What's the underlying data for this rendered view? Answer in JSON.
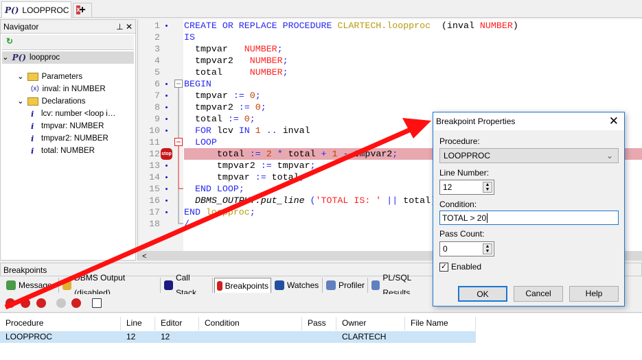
{
  "doc_tab": {
    "icon": "procedure-icon",
    "label": "LOOPPROC",
    "close": "x",
    "add": "+"
  },
  "navigator": {
    "title": "Navigator",
    "pin": "⊥",
    "close": "✕",
    "refresh": "↻",
    "root": "loopproc",
    "items": [
      {
        "label": "Parameters",
        "icon": "folder-icon"
      },
      {
        "label": "inval: in NUMBER",
        "icon": "parameter-icon",
        "glyph": "(x)"
      },
      {
        "label": "Declarations",
        "icon": "folder-icon"
      },
      {
        "label": "lcv: number  <loop i…",
        "icon": "variable-icon"
      },
      {
        "label": "tmpvar: NUMBER",
        "icon": "variable-icon"
      },
      {
        "label": "tmpvar2: NUMBER",
        "icon": "variable-icon"
      },
      {
        "label": "total: NUMBER",
        "icon": "variable-icon"
      }
    ]
  },
  "editor": {
    "breakpoint_line": 12,
    "breakpoint_label": "stop",
    "dots": [
      1,
      6,
      7,
      8,
      9,
      10,
      13,
      14,
      15,
      16,
      17
    ],
    "lines": [
      [
        [
          "kw",
          "CREATE OR REPLACE PROCEDURE "
        ],
        [
          "nm",
          "CLARTECH.loopproc"
        ],
        [
          "",
          "  (inval "
        ],
        [
          "ty",
          "NUMBER"
        ],
        [
          "",
          ")"
        ]
      ],
      [
        [
          "kw",
          "IS"
        ]
      ],
      [
        [
          "",
          "  tmpvar   "
        ],
        [
          "ty",
          "NUMBER"
        ],
        [
          "op",
          ";"
        ]
      ],
      [
        [
          "",
          "  tmpvar2   "
        ],
        [
          "ty",
          "NUMBER"
        ],
        [
          "op",
          ";"
        ]
      ],
      [
        [
          "",
          "  total     "
        ],
        [
          "ty",
          "NUMBER"
        ],
        [
          "op",
          ";"
        ]
      ],
      [
        [
          "kw",
          "BEGIN"
        ]
      ],
      [
        [
          "",
          "  tmpvar "
        ],
        [
          "op",
          ":="
        ],
        [
          "",
          " "
        ],
        [
          "nu",
          "0"
        ],
        [
          "op",
          ";"
        ]
      ],
      [
        [
          "",
          "  tmpvar2 "
        ],
        [
          "op",
          ":="
        ],
        [
          "",
          " "
        ],
        [
          "nu",
          "0"
        ],
        [
          "op",
          ";"
        ]
      ],
      [
        [
          "",
          "  total "
        ],
        [
          "op",
          ":="
        ],
        [
          "",
          " "
        ],
        [
          "nu",
          "0"
        ],
        [
          "op",
          ";"
        ]
      ],
      [
        [
          "",
          "  "
        ],
        [
          "kw",
          "FOR"
        ],
        [
          "",
          " lcv "
        ],
        [
          "kw",
          "IN"
        ],
        [
          "",
          " "
        ],
        [
          "nu",
          "1"
        ],
        [
          "",
          " "
        ],
        [
          "op",
          ".."
        ],
        [
          "",
          " inval"
        ]
      ],
      [
        [
          "",
          "  "
        ],
        [
          "kw",
          "LOOP"
        ]
      ],
      [
        [
          "",
          "      total "
        ],
        [
          "op",
          ":="
        ],
        [
          "nu",
          " 2 "
        ],
        [
          "op",
          "*"
        ],
        [
          "",
          " total "
        ],
        [
          "op",
          "+"
        ],
        [
          "nu",
          " 1 "
        ],
        [
          "op",
          "-"
        ],
        [
          "",
          " tmpvar2"
        ],
        [
          "op",
          ";"
        ]
      ],
      [
        [
          "",
          "      tmpvar2 "
        ],
        [
          "op",
          ":="
        ],
        [
          "",
          " tmpvar"
        ],
        [
          "op",
          ";"
        ]
      ],
      [
        [
          "",
          "      tmpvar "
        ],
        [
          "op",
          ":="
        ],
        [
          "",
          " total"
        ],
        [
          "op",
          ";"
        ]
      ],
      [
        [
          "",
          "  "
        ],
        [
          "kw",
          "END LOOP"
        ],
        [
          "op",
          ";"
        ]
      ],
      [
        [
          "",
          "  "
        ],
        [
          "it",
          "DBMS_OUTPUT.put_line"
        ],
        [
          "",
          " "
        ],
        [
          "op",
          "("
        ],
        [
          "st",
          "'TOTAL IS: '"
        ],
        [
          "op",
          " || "
        ],
        [
          "",
          "total);"
        ]
      ],
      [
        [
          "kw",
          "END "
        ],
        [
          "nm",
          "loopproc"
        ],
        [
          "op",
          ";"
        ]
      ],
      [
        [
          "op",
          "/"
        ]
      ]
    ]
  },
  "breakpoints_panel": {
    "title": "Breakpoints",
    "tabs": [
      {
        "label": "Messages",
        "icon": "messages-icon"
      },
      {
        "label": "DBMS Output (disabled)",
        "icon": "dbms-output-icon"
      },
      {
        "label": "Call Stack",
        "icon": "call-stack-icon"
      },
      {
        "label": "Breakpoints",
        "icon": "breakpoints-icon",
        "active": true
      },
      {
        "label": "Watches",
        "icon": "watches-icon"
      },
      {
        "label": "Profiler",
        "icon": "profiler-icon"
      },
      {
        "label": "PL/SQL Results",
        "icon": "plsql-results-icon"
      }
    ],
    "toolbar": [
      "breakpoint-properties-icon",
      "add-breakpoint-icon",
      "remove-breakpoint-icon",
      "disable-breakpoint-icon",
      "breakpoint-toggle-icon",
      "list-icon"
    ],
    "columns": [
      "Procedure",
      "Line",
      "Editor Line",
      "Condition",
      "Pass",
      "Owner",
      "File Name"
    ],
    "rows": [
      [
        "LOOPPROC",
        "12",
        "12",
        "",
        "",
        "CLARTECH",
        ""
      ]
    ]
  },
  "dialog": {
    "title": "Breakpoint Properties",
    "close": "✕",
    "procedure_label": "Procedure:",
    "procedure_value": "LOOPPROC",
    "line_label": "Line Number:",
    "line_value": "12",
    "condition_label": "Condition:",
    "condition_value": "TOTAL > 20",
    "pass_label": "Pass Count:",
    "pass_value": "0",
    "enabled_label": "Enabled",
    "enabled": true,
    "ok": "OK",
    "cancel": "Cancel",
    "help": "Help"
  },
  "colors": {
    "accent": "#1a76d2",
    "breakpoint_highlight": "#e8a8b0",
    "arrow": "#ff0000"
  }
}
